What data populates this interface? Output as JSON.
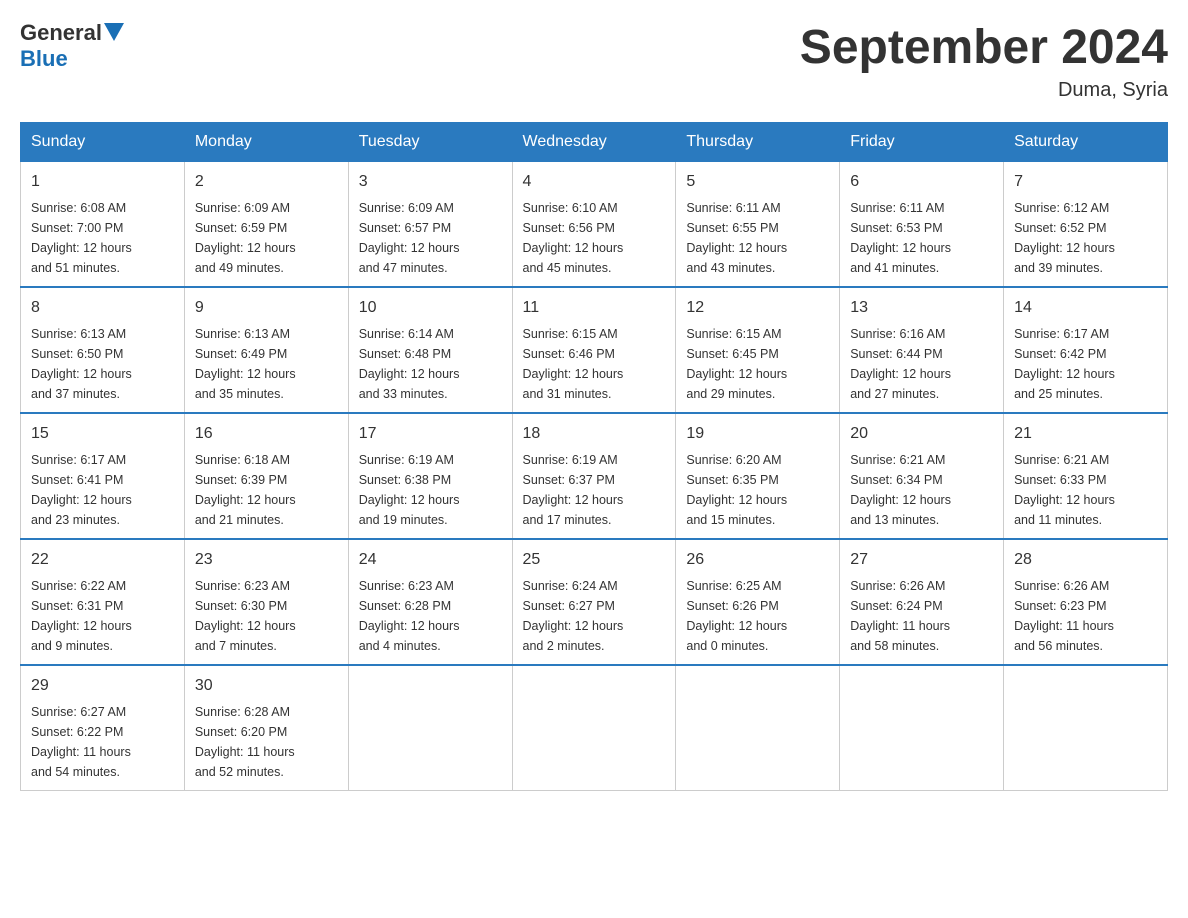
{
  "logo": {
    "general": "General",
    "blue": "Blue"
  },
  "title": "September 2024",
  "subtitle": "Duma, Syria",
  "days_of_week": [
    "Sunday",
    "Monday",
    "Tuesday",
    "Wednesday",
    "Thursday",
    "Friday",
    "Saturday"
  ],
  "weeks": [
    [
      {
        "day": "1",
        "sunrise": "6:08 AM",
        "sunset": "7:00 PM",
        "daylight": "12 hours and 51 minutes."
      },
      {
        "day": "2",
        "sunrise": "6:09 AM",
        "sunset": "6:59 PM",
        "daylight": "12 hours and 49 minutes."
      },
      {
        "day": "3",
        "sunrise": "6:09 AM",
        "sunset": "6:57 PM",
        "daylight": "12 hours and 47 minutes."
      },
      {
        "day": "4",
        "sunrise": "6:10 AM",
        "sunset": "6:56 PM",
        "daylight": "12 hours and 45 minutes."
      },
      {
        "day": "5",
        "sunrise": "6:11 AM",
        "sunset": "6:55 PM",
        "daylight": "12 hours and 43 minutes."
      },
      {
        "day": "6",
        "sunrise": "6:11 AM",
        "sunset": "6:53 PM",
        "daylight": "12 hours and 41 minutes."
      },
      {
        "day": "7",
        "sunrise": "6:12 AM",
        "sunset": "6:52 PM",
        "daylight": "12 hours and 39 minutes."
      }
    ],
    [
      {
        "day": "8",
        "sunrise": "6:13 AM",
        "sunset": "6:50 PM",
        "daylight": "12 hours and 37 minutes."
      },
      {
        "day": "9",
        "sunrise": "6:13 AM",
        "sunset": "6:49 PM",
        "daylight": "12 hours and 35 minutes."
      },
      {
        "day": "10",
        "sunrise": "6:14 AM",
        "sunset": "6:48 PM",
        "daylight": "12 hours and 33 minutes."
      },
      {
        "day": "11",
        "sunrise": "6:15 AM",
        "sunset": "6:46 PM",
        "daylight": "12 hours and 31 minutes."
      },
      {
        "day": "12",
        "sunrise": "6:15 AM",
        "sunset": "6:45 PM",
        "daylight": "12 hours and 29 minutes."
      },
      {
        "day": "13",
        "sunrise": "6:16 AM",
        "sunset": "6:44 PM",
        "daylight": "12 hours and 27 minutes."
      },
      {
        "day": "14",
        "sunrise": "6:17 AM",
        "sunset": "6:42 PM",
        "daylight": "12 hours and 25 minutes."
      }
    ],
    [
      {
        "day": "15",
        "sunrise": "6:17 AM",
        "sunset": "6:41 PM",
        "daylight": "12 hours and 23 minutes."
      },
      {
        "day": "16",
        "sunrise": "6:18 AM",
        "sunset": "6:39 PM",
        "daylight": "12 hours and 21 minutes."
      },
      {
        "day": "17",
        "sunrise": "6:19 AM",
        "sunset": "6:38 PM",
        "daylight": "12 hours and 19 minutes."
      },
      {
        "day": "18",
        "sunrise": "6:19 AM",
        "sunset": "6:37 PM",
        "daylight": "12 hours and 17 minutes."
      },
      {
        "day": "19",
        "sunrise": "6:20 AM",
        "sunset": "6:35 PM",
        "daylight": "12 hours and 15 minutes."
      },
      {
        "day": "20",
        "sunrise": "6:21 AM",
        "sunset": "6:34 PM",
        "daylight": "12 hours and 13 minutes."
      },
      {
        "day": "21",
        "sunrise": "6:21 AM",
        "sunset": "6:33 PM",
        "daylight": "12 hours and 11 minutes."
      }
    ],
    [
      {
        "day": "22",
        "sunrise": "6:22 AM",
        "sunset": "6:31 PM",
        "daylight": "12 hours and 9 minutes."
      },
      {
        "day": "23",
        "sunrise": "6:23 AM",
        "sunset": "6:30 PM",
        "daylight": "12 hours and 7 minutes."
      },
      {
        "day": "24",
        "sunrise": "6:23 AM",
        "sunset": "6:28 PM",
        "daylight": "12 hours and 4 minutes."
      },
      {
        "day": "25",
        "sunrise": "6:24 AM",
        "sunset": "6:27 PM",
        "daylight": "12 hours and 2 minutes."
      },
      {
        "day": "26",
        "sunrise": "6:25 AM",
        "sunset": "6:26 PM",
        "daylight": "12 hours and 0 minutes."
      },
      {
        "day": "27",
        "sunrise": "6:26 AM",
        "sunset": "6:24 PM",
        "daylight": "11 hours and 58 minutes."
      },
      {
        "day": "28",
        "sunrise": "6:26 AM",
        "sunset": "6:23 PM",
        "daylight": "11 hours and 56 minutes."
      }
    ],
    [
      {
        "day": "29",
        "sunrise": "6:27 AM",
        "sunset": "6:22 PM",
        "daylight": "11 hours and 54 minutes."
      },
      {
        "day": "30",
        "sunrise": "6:28 AM",
        "sunset": "6:20 PM",
        "daylight": "11 hours and 52 minutes."
      },
      null,
      null,
      null,
      null,
      null
    ]
  ],
  "labels": {
    "sunrise": "Sunrise:",
    "sunset": "Sunset:",
    "daylight": "Daylight:"
  }
}
